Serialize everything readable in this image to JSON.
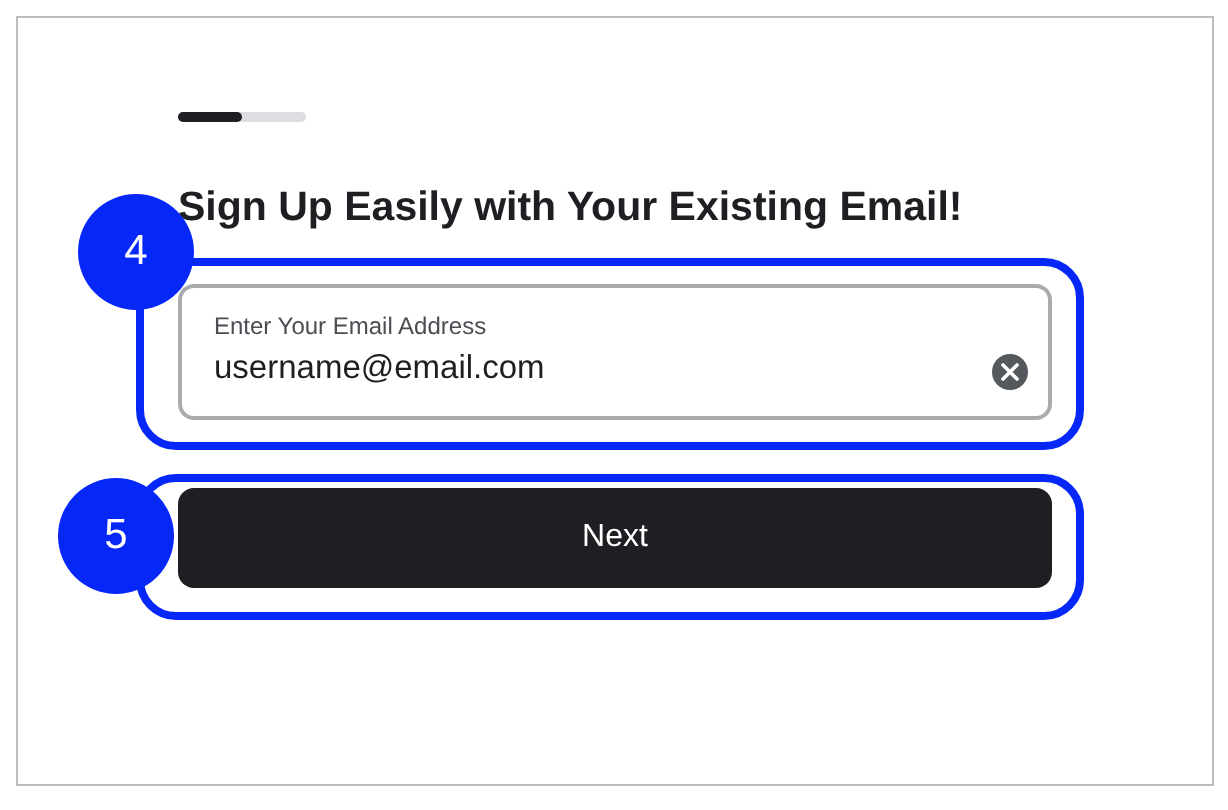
{
  "progress": {
    "level": 0.5
  },
  "heading": "Sign Up Easily with Your Existing Email!",
  "email_field": {
    "label": "Enter Your Email Address",
    "value": "username@email.com",
    "callout": "4"
  },
  "next_button": {
    "label": "Next",
    "callout": "5"
  }
}
